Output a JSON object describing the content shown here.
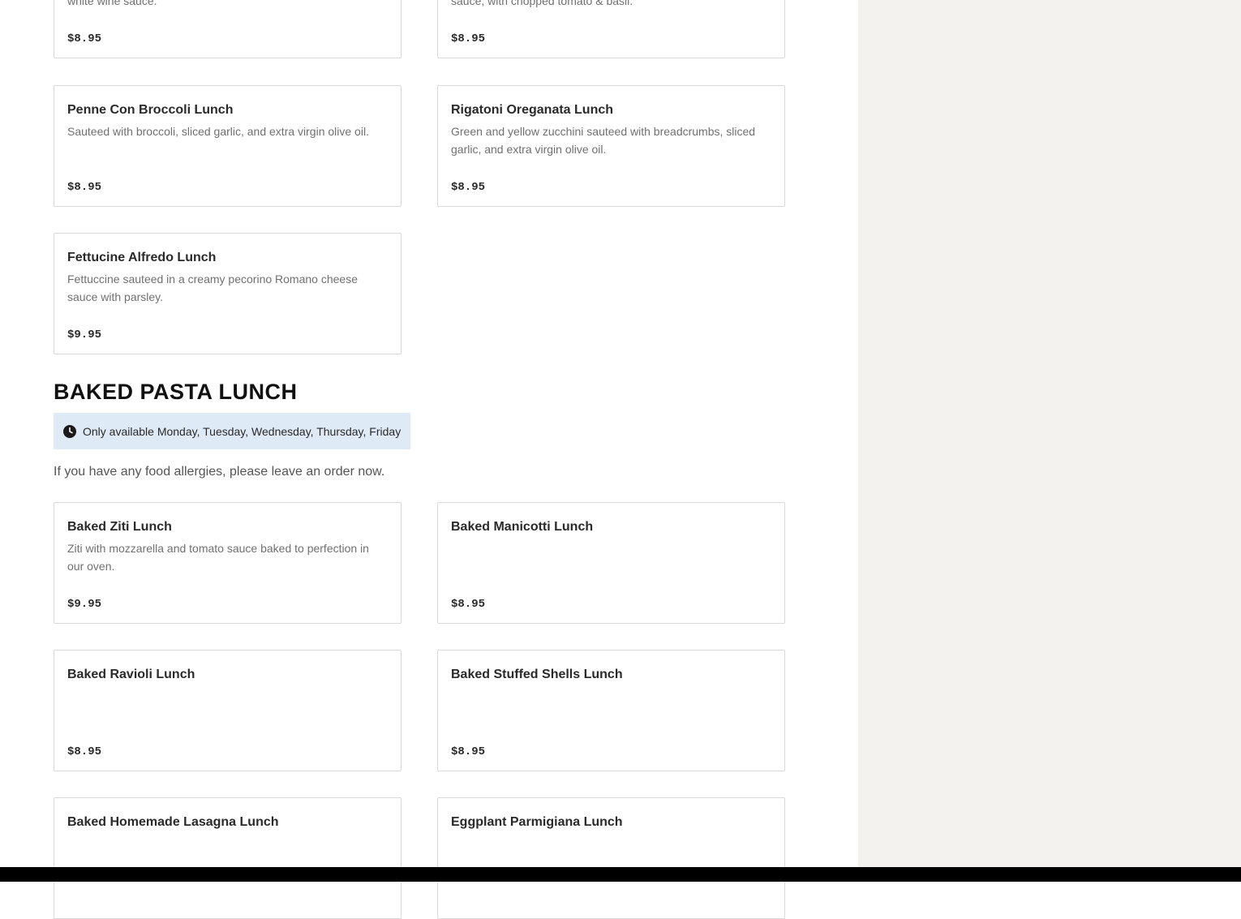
{
  "top_items": [
    {
      "description": "white wine sauce.",
      "price": "$8.95"
    },
    {
      "description": "sauce, with chopped tomato & basil.",
      "price": "$8.95"
    }
  ],
  "items": [
    {
      "name": "Penne Con Broccoli Lunch",
      "description": "Sauteed with broccoli, sliced garlic, and extra virgin olive oil.",
      "price": "$8.95"
    },
    {
      "name": "Rigatoni Oreganata Lunch",
      "description": "Green and yellow zucchini sauteed with breadcrumbs, sliced garlic, and extra virgin olive oil.",
      "price": "$8.95"
    },
    {
      "name": "Fettucine Alfredo Lunch",
      "description": "Fettuccine sauteed in a creamy pecorino Romano cheese sauce with parsley.",
      "price": "$9.95"
    }
  ],
  "baked_section": {
    "title": "BAKED PASTA LUNCH",
    "availability": "Only available Monday, Tuesday, Wednesday, Thursday, Friday",
    "note": "If you have any food allergies, please leave an order now.",
    "items": [
      {
        "name": "Baked Ziti Lunch",
        "description": "Ziti with mozzarella and tomato sauce baked to perfection in our oven.",
        "price": "$9.95"
      },
      {
        "name": "Baked Manicotti Lunch",
        "description": "",
        "price": "$8.95"
      },
      {
        "name": "Baked Ravioli Lunch",
        "description": "",
        "price": "$8.95"
      },
      {
        "name": "Baked Stuffed Shells Lunch",
        "description": "",
        "price": "$8.95"
      },
      {
        "name": "Baked Homemade Lasagna Lunch",
        "description": "",
        "price": ""
      },
      {
        "name": "Eggplant Parmigiana Lunch",
        "description": "",
        "price": ""
      }
    ]
  },
  "icons": {
    "availability": "clock-icon"
  },
  "colors": {
    "availability_bg": "#dfeaf7",
    "sidebar_bg": "#f3f2ef",
    "border": "#d9d9d9"
  }
}
